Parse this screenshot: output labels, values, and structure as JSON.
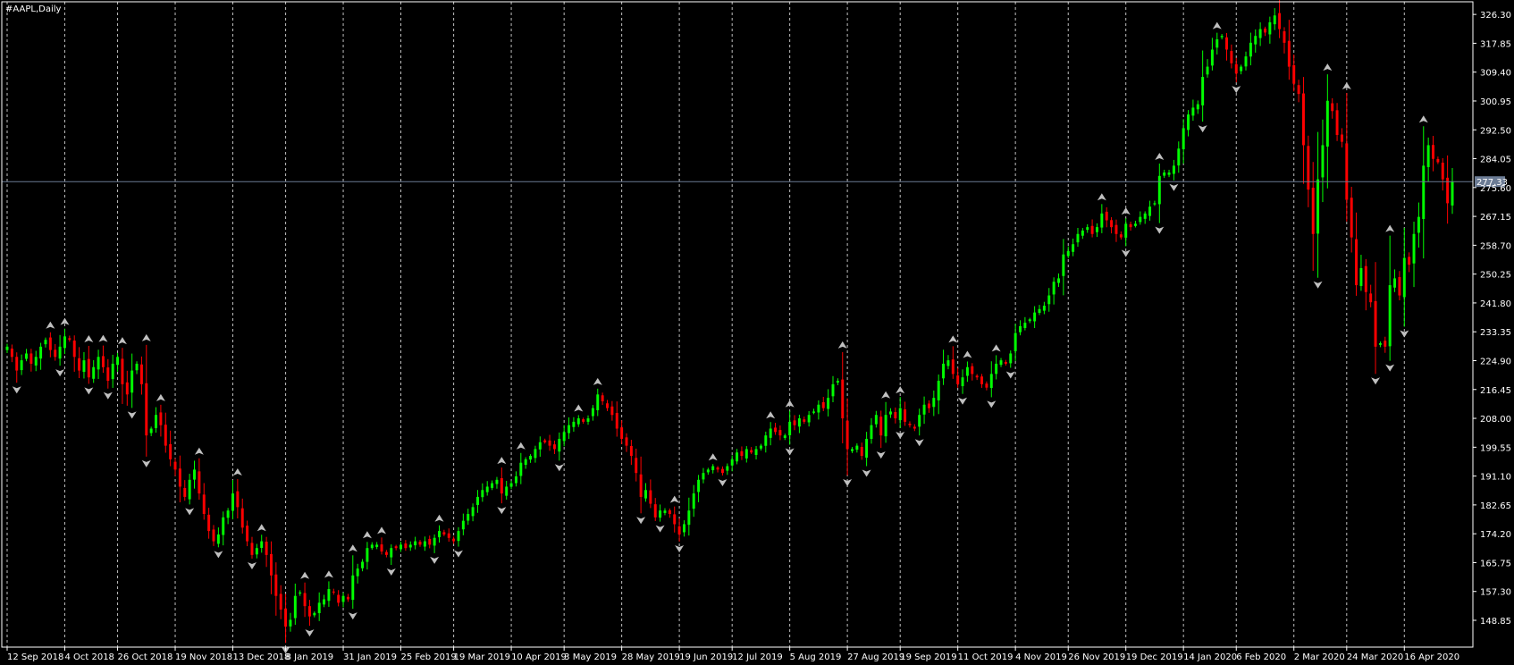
{
  "window": {
    "symbol_label": "#AAPL,Daily"
  },
  "colors": {
    "background": "#000000",
    "frame": "#ffffff",
    "grid": "#ffffff",
    "bull": "#00ff00",
    "bear": "#ff0000",
    "fractal": "#c0c0c0",
    "price_line": "#6b7b94",
    "price_box": "#6b7b94"
  },
  "chart_data": {
    "type": "candlestick",
    "title": "#AAPL,Daily",
    "grid": true,
    "current_price": 277.33,
    "current_price_label": "277.33",
    "ylim": [
      141,
      330
    ],
    "y_ticks": [
      "326.30",
      "317.85",
      "309.40",
      "300.95",
      "292.50",
      "284.05",
      "275.60",
      "267.15",
      "258.70",
      "250.25",
      "241.80",
      "233.35",
      "224.90",
      "216.45",
      "208.00",
      "199.55",
      "191.10",
      "182.65",
      "174.20",
      "165.75",
      "157.30",
      "148.85"
    ],
    "x_labels": [
      "12 Sep 2018",
      "4 Oct 2018",
      "26 Oct 2018",
      "19 Nov 2018",
      "13 Dec 2018",
      "8 Jan 2019",
      "31 Jan 2019",
      "25 Feb 2019",
      "19 Mar 2019",
      "10 Apr 2019",
      "3 May 2019",
      "28 May 2019",
      "19 Jun 2019",
      "12 Jul 2019",
      "5 Aug 2019",
      "27 Aug 2019",
      "19 Sep 2019",
      "11 Oct 2019",
      "4 Nov 2019",
      "26 Nov 2019",
      "19 Dec 2019",
      "14 Jan 2020",
      "6 Feb 2020",
      "2 Mar 2020",
      "24 Mar 2020",
      "16 Apr 2020"
    ],
    "closes": [
      229,
      226,
      222,
      225,
      227,
      224,
      226,
      229,
      231,
      228,
      226,
      229,
      232,
      231,
      226,
      222,
      225,
      220,
      223,
      226,
      223,
      219,
      224,
      226,
      218,
      215,
      222,
      224,
      218,
      203,
      205,
      209,
      206,
      200,
      196,
      193,
      188,
      185,
      190,
      193,
      186,
      180,
      175,
      172,
      174,
      179,
      181,
      186,
      182,
      176,
      172,
      168,
      170,
      172,
      168,
      162,
      156,
      152,
      147,
      149,
      156,
      157,
      153,
      150,
      151,
      154,
      155,
      158,
      157,
      154,
      156,
      155,
      162,
      164,
      166,
      170,
      171,
      171,
      169,
      168,
      170,
      170,
      171,
      170,
      171,
      172,
      171,
      172,
      171,
      173,
      175,
      174,
      173,
      172,
      175,
      178,
      180,
      182,
      185,
      187,
      188,
      189,
      190,
      186,
      188,
      189,
      191,
      195,
      196,
      197,
      199,
      201,
      201,
      200,
      199,
      202,
      204,
      206,
      207,
      208,
      207,
      208,
      211,
      215,
      213,
      211,
      209,
      205,
      202,
      200,
      197,
      192,
      185,
      187,
      183,
      179,
      181,
      181,
      180,
      177,
      174,
      177,
      181,
      186,
      190,
      192,
      193,
      194,
      193,
      192,
      194,
      196,
      198,
      197,
      199,
      198,
      199,
      200,
      203,
      205,
      204,
      203,
      203,
      207,
      206,
      208,
      207,
      209,
      210,
      212,
      211,
      214,
      218,
      219,
      208,
      199,
      199,
      200,
      197,
      202,
      206,
      209,
      203,
      209,
      210,
      208,
      211,
      207,
      206,
      205,
      209,
      212,
      211,
      214,
      219,
      224,
      225,
      221,
      218,
      220,
      223,
      221,
      220,
      218,
      217,
      221,
      224,
      225,
      224,
      227,
      233,
      235,
      236,
      237,
      239,
      240,
      241,
      244,
      248,
      249,
      256,
      257,
      259,
      262,
      263,
      264,
      262,
      264,
      268,
      266,
      264,
      262,
      261,
      265,
      264,
      265,
      267,
      268,
      270,
      271,
      279,
      280,
      280,
      282,
      287,
      293,
      297,
      299,
      300,
      308,
      311,
      316,
      319,
      320,
      316,
      312,
      309,
      311,
      314,
      318,
      320,
      322,
      321,
      324,
      326,
      322,
      318,
      311,
      306,
      303,
      288,
      275,
      262,
      278,
      288,
      301,
      298,
      291,
      289,
      272,
      261,
      247,
      252,
      245,
      242,
      229,
      230,
      229,
      247,
      249,
      244,
      255,
      253,
      262,
      267,
      282,
      288,
      284,
      283,
      278,
      271,
      277.33
    ]
  }
}
